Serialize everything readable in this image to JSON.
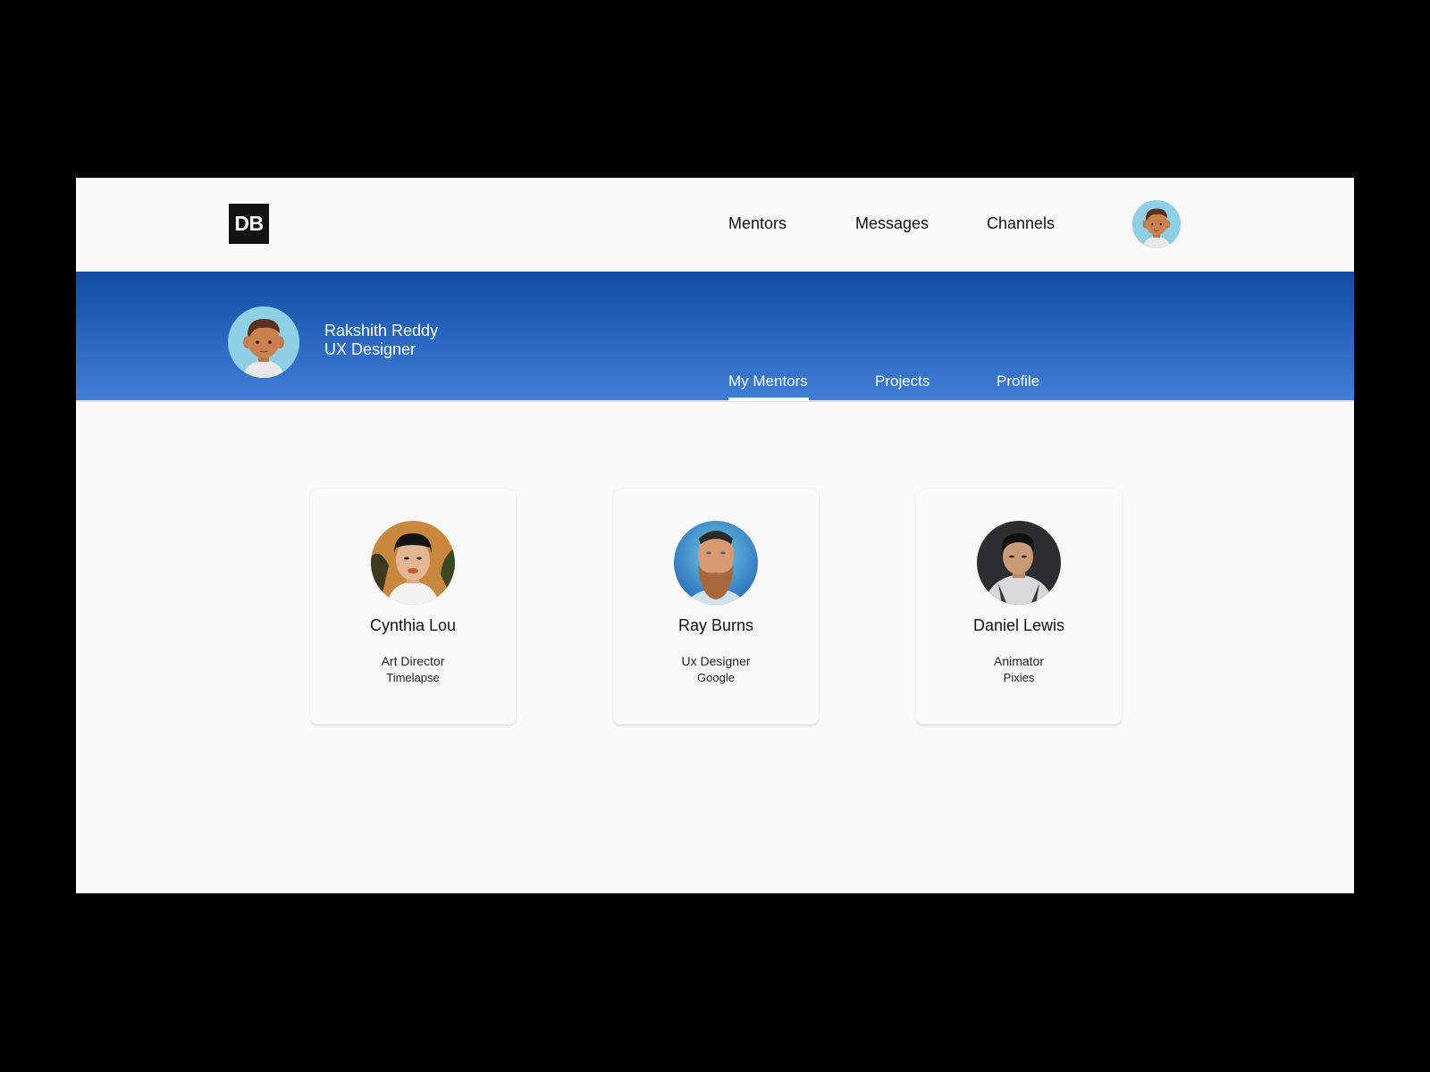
{
  "header": {
    "logo_text": "DB",
    "nav": [
      {
        "label": "Mentors"
      },
      {
        "label": "Messages"
      },
      {
        "label": "Channels"
      }
    ],
    "avatar_icon": "user-avatar-icon"
  },
  "profile": {
    "name": "Rakshith Reddy",
    "role": "UX Designer",
    "avatar_icon": "user-avatar-icon"
  },
  "tabs": [
    {
      "label": "My Mentors",
      "active": true
    },
    {
      "label": "Projects",
      "active": false
    },
    {
      "label": "Profile",
      "active": false
    }
  ],
  "mentors": [
    {
      "name": "Cynthia Lou",
      "title": "Art Director",
      "company": "Timelapse"
    },
    {
      "name": "Ray Burns",
      "title": "Ux Designer",
      "company": "Google"
    },
    {
      "name": "Daniel Lewis",
      "title": "Animator",
      "company": "Pixies"
    }
  ],
  "colors": {
    "banner_top": "#0f4ea3",
    "banner_bottom": "#3f7fd4",
    "background": "#fafafa",
    "logo_bg": "#141414",
    "avatar_bg": "#8ecfe6"
  }
}
